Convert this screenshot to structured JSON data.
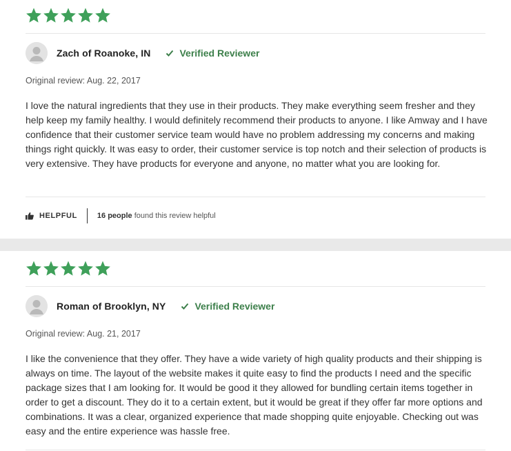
{
  "colors": {
    "star": "#3fa05a",
    "verified": "#3c7f4a",
    "separator": "#e9e9e9"
  },
  "reviews": [
    {
      "rating": 5,
      "reviewer": "Zach of Roanoke, IN",
      "verified_label": "Verified Reviewer",
      "original_review": "Original review: Aug. 22, 2017",
      "text": "I love the natural ingredients that they use in their products. They make everything seem fresher and they help keep my family healthy. I would definitely recommend their products to anyone. I like Amway and I have confidence that their customer service team would have no problem addressing my concerns and making things right quickly. It was easy to order, their customer service is top notch and their selection of products is very extensive. They have products for everyone and anyone, no matter what you are looking for.",
      "helpful_label": "HELPFUL",
      "helpful_count": "16 people",
      "helpful_suffix": " found this review helpful"
    },
    {
      "rating": 5,
      "reviewer": "Roman of Brooklyn, NY",
      "verified_label": "Verified Reviewer",
      "original_review": "Original review: Aug. 21, 2017",
      "text": "I like the convenience that they offer. They have a wide variety of high quality products and their shipping is always on time. The layout of the website makes it quite easy to find the products I need and the specific package sizes that I am looking for. It would be good it they allowed for bundling certain items together in order to get a discount. They do it to a certain extent, but it would be great if they offer far more options and combinations. It was a clear, organized experience that made shopping quite enjoyable. Checking out was easy and the entire experience was hassle free."
    }
  ]
}
